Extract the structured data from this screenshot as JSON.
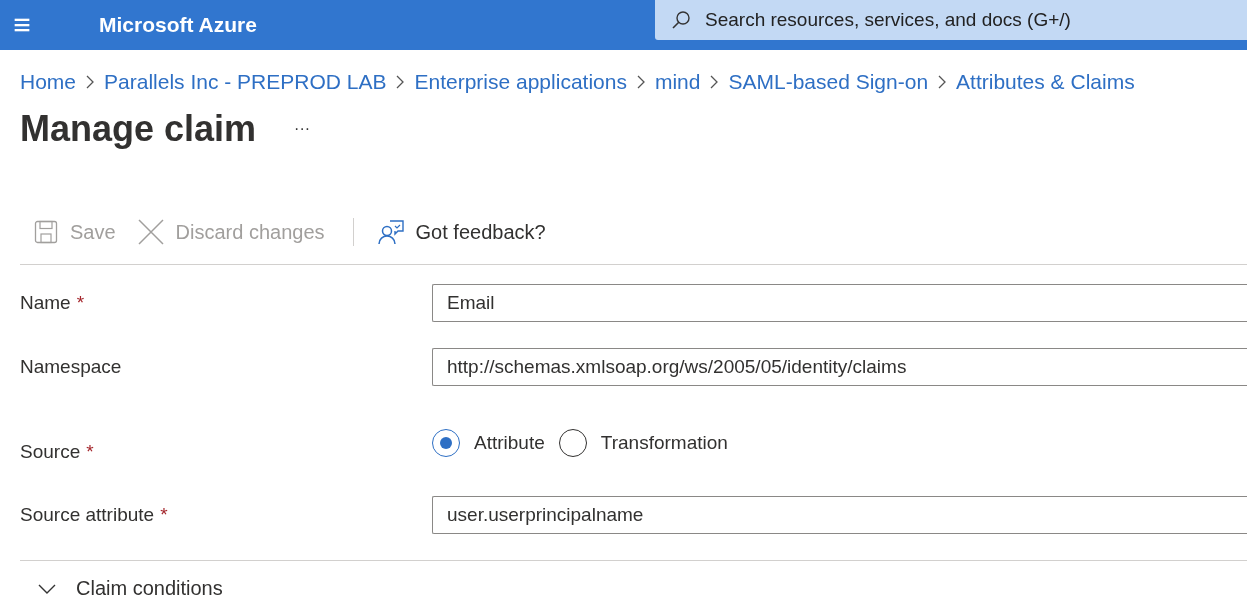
{
  "top_bar": {
    "menu_icon": "≡",
    "brand": "Microsoft Azure",
    "search": {
      "placeholder": "Search resources, services, and docs (G+/)"
    }
  },
  "breadcrumb": [
    "Home",
    "Parallels Inc - PREPROD LAB",
    "Enterprise applications",
    "mind",
    "SAML-based Sign-on",
    "Attributes & Claims"
  ],
  "page": {
    "title": "Manage claim",
    "more": "···"
  },
  "toolbar": [
    {
      "kind": "save",
      "label": "Save",
      "disabled": true
    },
    {
      "kind": "discard",
      "label": "Discard changes",
      "disabled": true
    },
    {
      "kind": "feedback",
      "label": "Got feedback?",
      "disabled": false
    }
  ],
  "form": [
    {
      "kind": "text",
      "label": "Name",
      "required_mark": "*",
      "value": "Email"
    },
    {
      "kind": "text",
      "label": "Namespace",
      "value": "http://schemas.xmlsoap.org/ws/2005/05/identity/claims"
    },
    {
      "kind": "radio",
      "label": "Source",
      "required_mark": "*",
      "options": [
        {
          "label": "Attribute",
          "selected": true
        },
        {
          "label": "Transformation",
          "selected": false
        }
      ]
    },
    {
      "kind": "text",
      "label": "Source attribute",
      "required_mark": "*",
      "value": "user.userprincipalname"
    }
  ],
  "claim_conditions": {
    "label": "Claim conditions",
    "expanded": false
  }
}
